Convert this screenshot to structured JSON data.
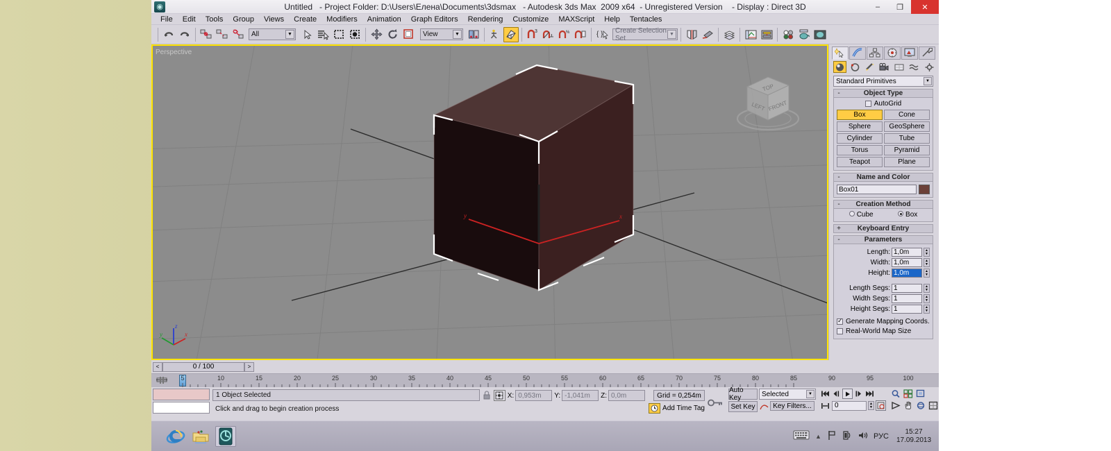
{
  "window": {
    "title_parts": [
      "Untitled",
      "   - Project Folder: D:\\Users\\Елена\\Documents\\3dsmax",
      "   - Autodesk 3ds Max  2009 x64",
      "  - Unregistered Version",
      "    - Display : Direct 3D"
    ],
    "logo": "3dsmax-logo-icon",
    "minimize": "–",
    "maximize": "❐",
    "close": "✕"
  },
  "menu": [
    "File",
    "Edit",
    "Tools",
    "Group",
    "Views",
    "Create",
    "Modifiers",
    "Animation",
    "Graph Editors",
    "Rendering",
    "Customize",
    "MAXScript",
    "Help",
    "Tentacles"
  ],
  "toolbar": {
    "selection_filter": "All",
    "reference_coord": "View",
    "named_selection_sets_placeholder": "Create Selection Set",
    "snap_degrees": "3",
    "snap_percent": "%",
    "buttons": [
      {
        "name": "undo-button",
        "glyph": "↶"
      },
      {
        "name": "redo-button",
        "glyph": "↷"
      },
      {
        "name": "select-and-link-button",
        "glyph": "⛓"
      },
      {
        "name": "unlink-selection-button",
        "glyph": "⛓"
      },
      {
        "name": "bind-to-space-warp-button",
        "glyph": "◌"
      },
      {
        "name": "select-object-button",
        "glyph": "↖"
      },
      {
        "name": "select-by-name-button",
        "glyph": "≣"
      },
      {
        "name": "rectangular-selection-region-button",
        "glyph": "▣"
      },
      {
        "name": "window-crossing-toggle-button",
        "glyph": "◓"
      },
      {
        "name": "select-and-move-button",
        "glyph": "✥"
      },
      {
        "name": "select-and-rotate-button",
        "glyph": "↻"
      },
      {
        "name": "select-and-scale-button",
        "glyph": "◰"
      },
      {
        "name": "mirror-button",
        "glyph": "◫"
      },
      {
        "name": "align-button",
        "glyph": "◨"
      },
      {
        "name": "layer-manager-button",
        "glyph": "≋"
      },
      {
        "name": "curve-editor-button",
        "glyph": "▤"
      },
      {
        "name": "schematic-view-button",
        "glyph": "▦"
      },
      {
        "name": "material-editor-button",
        "glyph": "◕"
      },
      {
        "name": "render-setup-button",
        "glyph": "🫖"
      },
      {
        "name": "rendered-frame-window-button",
        "glyph": "▣"
      }
    ]
  },
  "viewport": {
    "label": "Perspective",
    "object_color": "#4a2a2a",
    "selection_bracket_color": "#ffffff",
    "gizmo_labels": {
      "x": "x",
      "y": "y",
      "z": "z"
    },
    "tripod_labels": {
      "x": "x",
      "y": "y",
      "z": "z"
    },
    "viewcube_faces": {
      "top": "TOP",
      "left": "LEFT",
      "front": "FRONT"
    },
    "background": "#8c8c8c"
  },
  "command_panel": {
    "tabs": [
      {
        "name": "create-tab",
        "glyph": "✨",
        "selected": true
      },
      {
        "name": "modify-tab",
        "glyph": "◜",
        "selected": false
      },
      {
        "name": "hierarchy-tab",
        "glyph": "⛓",
        "selected": false
      },
      {
        "name": "motion-tab",
        "glyph": "◎",
        "selected": false
      },
      {
        "name": "display-tab",
        "glyph": "🖵",
        "selected": false
      },
      {
        "name": "utilities-tab",
        "glyph": "⚒",
        "selected": false
      }
    ],
    "subtabs": [
      {
        "name": "geometry-subtab",
        "glyph": "⬤",
        "selected": true
      },
      {
        "name": "shapes-subtab",
        "glyph": "◔",
        "selected": false
      },
      {
        "name": "lights-subtab",
        "glyph": "✦",
        "selected": false
      },
      {
        "name": "cameras-subtab",
        "glyph": "🎥",
        "selected": false
      },
      {
        "name": "helpers-subtab",
        "glyph": "▭",
        "selected": false
      },
      {
        "name": "space-warps-subtab",
        "glyph": "≈",
        "selected": false
      },
      {
        "name": "systems-subtab",
        "glyph": "⚙",
        "selected": false
      }
    ],
    "category": "Standard Primitives",
    "object_type": {
      "title": "Object Type",
      "autogrid_label": "AutoGrid",
      "autogrid_checked": false,
      "buttons": [
        {
          "label": "Box",
          "selected": true
        },
        {
          "label": "Cone",
          "selected": false
        },
        {
          "label": "Sphere",
          "selected": false
        },
        {
          "label": "GeoSphere",
          "selected": false
        },
        {
          "label": "Cylinder",
          "selected": false
        },
        {
          "label": "Tube",
          "selected": false
        },
        {
          "label": "Torus",
          "selected": false
        },
        {
          "label": "Pyramid",
          "selected": false
        },
        {
          "label": "Teapot",
          "selected": false
        },
        {
          "label": "Plane",
          "selected": false
        }
      ]
    },
    "name_and_color": {
      "title": "Name and Color",
      "name": "Box01",
      "color": "#6b4038"
    },
    "creation_method": {
      "title": "Creation Method",
      "options": [
        {
          "label": "Cube",
          "selected": false
        },
        {
          "label": "Box",
          "selected": true
        }
      ]
    },
    "keyboard_entry": {
      "title": "Keyboard Entry",
      "collapsed": true
    },
    "parameters": {
      "title": "Parameters",
      "fields": [
        {
          "label": "Length:",
          "value": "1,0m",
          "selected": false
        },
        {
          "label": "Width:",
          "value": "1,0m",
          "selected": false
        },
        {
          "label": "Height:",
          "value": "1,0m",
          "selected": true
        },
        {
          "label": "Length Segs:",
          "value": "1",
          "selected": false
        },
        {
          "label": "Width Segs:",
          "value": "1",
          "selected": false
        },
        {
          "label": "Height Segs:",
          "value": "1",
          "selected": false
        }
      ],
      "checkboxes": [
        {
          "label": "Generate Mapping Coords.",
          "checked": true
        },
        {
          "label": "Real-World Map Size",
          "checked": false
        }
      ]
    }
  },
  "timeline": {
    "prev_frame": "<",
    "next_frame": ">",
    "frame_counter": "0 / 100",
    "ruler_labels": [
      "5",
      "10",
      "15",
      "20",
      "25",
      "30",
      "35",
      "40",
      "45",
      "50",
      "55",
      "60",
      "65",
      "70",
      "75",
      "80",
      "85",
      "90",
      "95",
      "100"
    ],
    "slider_position": "0"
  },
  "statusbar": {
    "prompt": "1 Object Selected",
    "hint": "Click and drag to begin creation process",
    "lock_icon": "lock-icon",
    "absolute_mode_icon": "absolute-relative-toggle-icon",
    "coords": [
      {
        "label": "X:",
        "value": "0,953m"
      },
      {
        "label": "Y:",
        "value": "-1,041m"
      },
      {
        "label": "Z:",
        "value": "0,0m"
      }
    ],
    "grid": "Grid = 0,254m",
    "add_time_tag": "Add Time Tag",
    "key_mode_icon": "key-mode-toggle-icon",
    "auto_key": "Auto Key",
    "set_key": "Set Key",
    "key_filters": "Key Filters...",
    "selection_level": "Selected",
    "curve_icon": "curve-icon",
    "playback": [
      {
        "name": "go-to-start-button",
        "glyph": "⏮"
      },
      {
        "name": "previous-frame-button",
        "glyph": "◀|"
      },
      {
        "name": "play-animation-button",
        "glyph": "▶"
      },
      {
        "name": "next-frame-button",
        "glyph": "|▶"
      },
      {
        "name": "go-to-end-button",
        "glyph": "⏭"
      }
    ],
    "current_frame": "0",
    "key_nav_icon": "key-mode-icon",
    "time-config-icon": "time-configuration-icon",
    "nav": [
      {
        "name": "zoom-button",
        "glyph": "🔍"
      },
      {
        "name": "zoom-all-button",
        "glyph": "⊞"
      },
      {
        "name": "zoom-extents-button",
        "glyph": "⊡"
      },
      {
        "name": "field-of-view-button",
        "glyph": "▷"
      },
      {
        "name": "pan-view-button",
        "glyph": "✋"
      },
      {
        "name": "orbit-button",
        "glyph": "⟳"
      },
      {
        "name": "maximize-viewport-toggle-button",
        "glyph": "⛶"
      }
    ]
  },
  "taskbar": {
    "items": [
      {
        "name": "internet-explorer-icon",
        "label": "e"
      },
      {
        "name": "file-explorer-icon",
        "label": "folder"
      },
      {
        "name": "3dsmax-taskbar-icon",
        "label": "3dsmax",
        "active": true
      }
    ],
    "tray": {
      "keyboard_icon": "on-screen-keyboard-icon",
      "show_hidden_icon": "▲",
      "flag_icon": "action-center-icon",
      "network_icon": "network-icon",
      "volume_icon": "volume-icon",
      "language": "РУС",
      "time": "15:27",
      "date": "17.09.2013"
    }
  }
}
